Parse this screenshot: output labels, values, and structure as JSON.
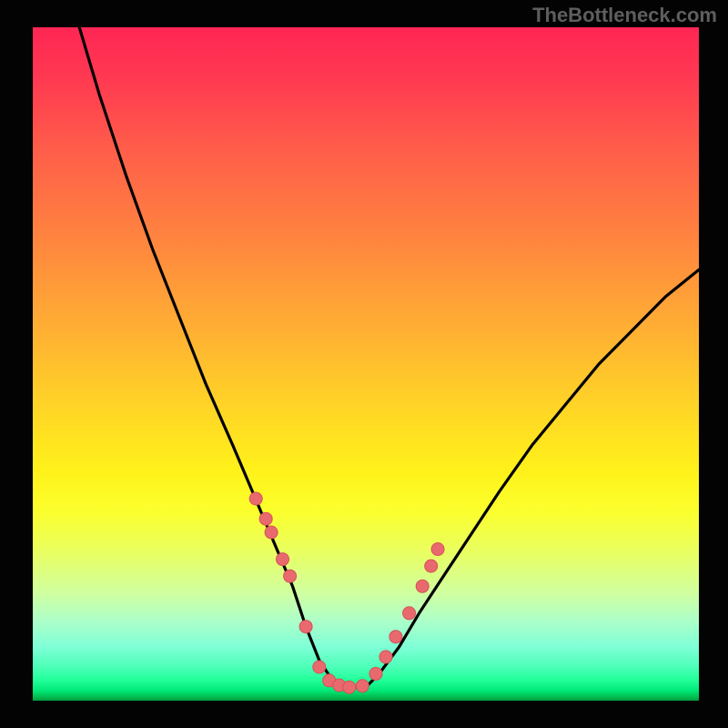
{
  "watermark": "TheBottleneck.com",
  "chart_data": {
    "type": "line",
    "title": "",
    "xlabel": "",
    "ylabel": "",
    "xlim": [
      0,
      100
    ],
    "ylim": [
      0,
      100
    ],
    "curve": {
      "name": "bottleneck-curve",
      "description": "V-shaped bottleneck curve with minimum plateau near x≈43–50",
      "x": [
        7,
        10,
        14,
        18,
        22,
        26,
        30,
        33,
        36,
        39,
        41,
        43,
        45,
        47,
        50,
        52,
        55,
        58,
        62,
        66,
        70,
        75,
        80,
        85,
        90,
        95,
        100
      ],
      "y": [
        100,
        90,
        78,
        67,
        57,
        47,
        38,
        31,
        24,
        17,
        11,
        6,
        3,
        2,
        2,
        4,
        8,
        13,
        19,
        25,
        31,
        38,
        44,
        50,
        55,
        60,
        64
      ]
    },
    "markers": {
      "name": "highlight-points",
      "x": [
        33.5,
        35.0,
        35.8,
        37.5,
        38.6,
        41.0,
        43.0,
        44.5,
        46.0,
        47.5,
        49.5,
        51.5,
        53.0,
        54.5,
        56.5,
        58.5,
        59.8,
        60.8
      ],
      "y": [
        30.0,
        27.0,
        25.0,
        21.0,
        18.5,
        11.0,
        5.0,
        3.0,
        2.3,
        2.0,
        2.2,
        4.0,
        6.5,
        9.5,
        13.0,
        17.0,
        20.0,
        22.5
      ]
    },
    "background_gradient": {
      "top": "#ff2654",
      "mid": "#fff21a",
      "bottom": "#009c3e"
    }
  }
}
